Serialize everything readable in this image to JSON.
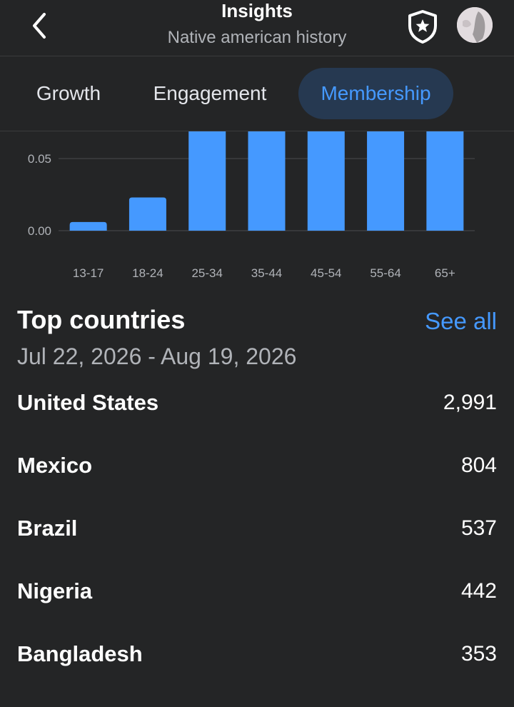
{
  "header": {
    "title": "Insights",
    "subtitle": "Native american history",
    "back_icon": "chevron-left-icon",
    "shield_icon": "shield-star-icon",
    "avatar_icon": "profile-avatar"
  },
  "tabs": [
    {
      "label": "Growth",
      "active": false
    },
    {
      "label": "Engagement",
      "active": false
    },
    {
      "label": "Membership",
      "active": true
    }
  ],
  "chart_data": {
    "type": "bar",
    "categories": [
      "13-17",
      "18-24",
      "25-34",
      "35-44",
      "45-54",
      "55-64",
      "65+"
    ],
    "values": [
      0.006,
      0.023,
      0.07,
      0.07,
      0.07,
      0.07,
      0.07
    ],
    "y_ticks": [
      "0.05",
      "0.00"
    ],
    "ylim": [
      0,
      0.05
    ],
    "bar_color": "#4599ff",
    "grid": true
  },
  "top_countries": {
    "title": "Top countries",
    "see_all": "See all",
    "date_range": "Jul 22, 2026 - Aug 19, 2026",
    "rows": [
      {
        "country": "United States",
        "count": "2,991"
      },
      {
        "country": "Mexico",
        "count": "804"
      },
      {
        "country": "Brazil",
        "count": "537"
      },
      {
        "country": "Nigeria",
        "count": "442"
      },
      {
        "country": "Bangladesh",
        "count": "353"
      }
    ]
  },
  "colors": {
    "background": "#242526",
    "accent": "#4599ff",
    "active_tab_bg": "#263951",
    "secondary_text": "#b0b3b8"
  }
}
